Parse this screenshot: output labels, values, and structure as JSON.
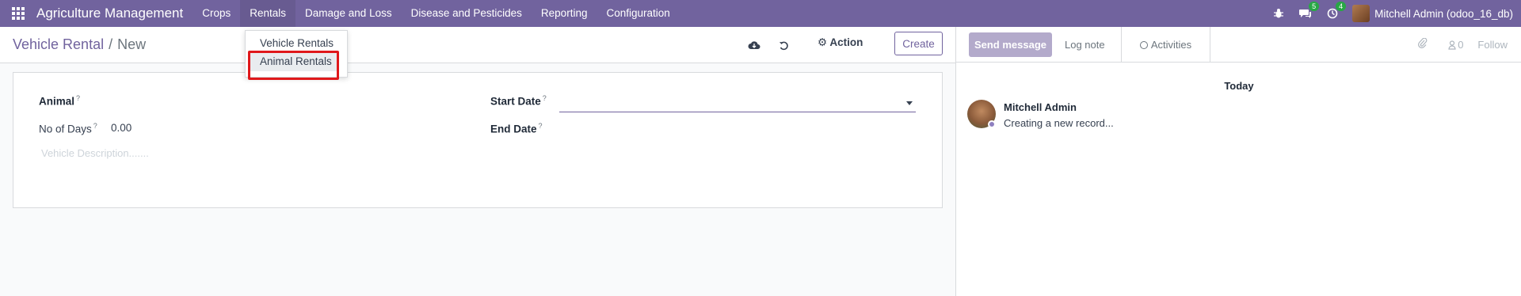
{
  "navbar": {
    "brand": "Agriculture Management",
    "menu": [
      "Crops",
      "Rentals",
      "Damage and Loss",
      "Disease and Pesticides",
      "Reporting",
      "Configuration"
    ],
    "active_menu": "Rentals",
    "messages_badge": "5",
    "activities_badge": "4",
    "user": "Mitchell Admin (odoo_16_db)",
    "accent_color": "#71639e"
  },
  "control": {
    "breadcrumb_parent": "Vehicle Rental",
    "breadcrumb_separator": "/",
    "breadcrumb_current": "New",
    "action_label": "Action",
    "create_label": "Create"
  },
  "dropdown": {
    "items": [
      "Vehicle Rentals",
      "Animal Rentals"
    ],
    "highlighted": "Animal Rentals"
  },
  "form": {
    "animal_label": "Animal",
    "days_label": "No of Days",
    "days_value": "0.00",
    "description_placeholder": "Vehicle Description.......",
    "start_date_label": "Start Date",
    "end_date_label": "End Date",
    "help_mark": "?"
  },
  "chatter": {
    "send_message": "Send message",
    "log_note": "Log note",
    "activities": "Activities",
    "followers_count": "0",
    "follow": "Follow",
    "date_separator": "Today",
    "message_author": "Mitchell Admin",
    "message_body": "Creating a new record..."
  }
}
